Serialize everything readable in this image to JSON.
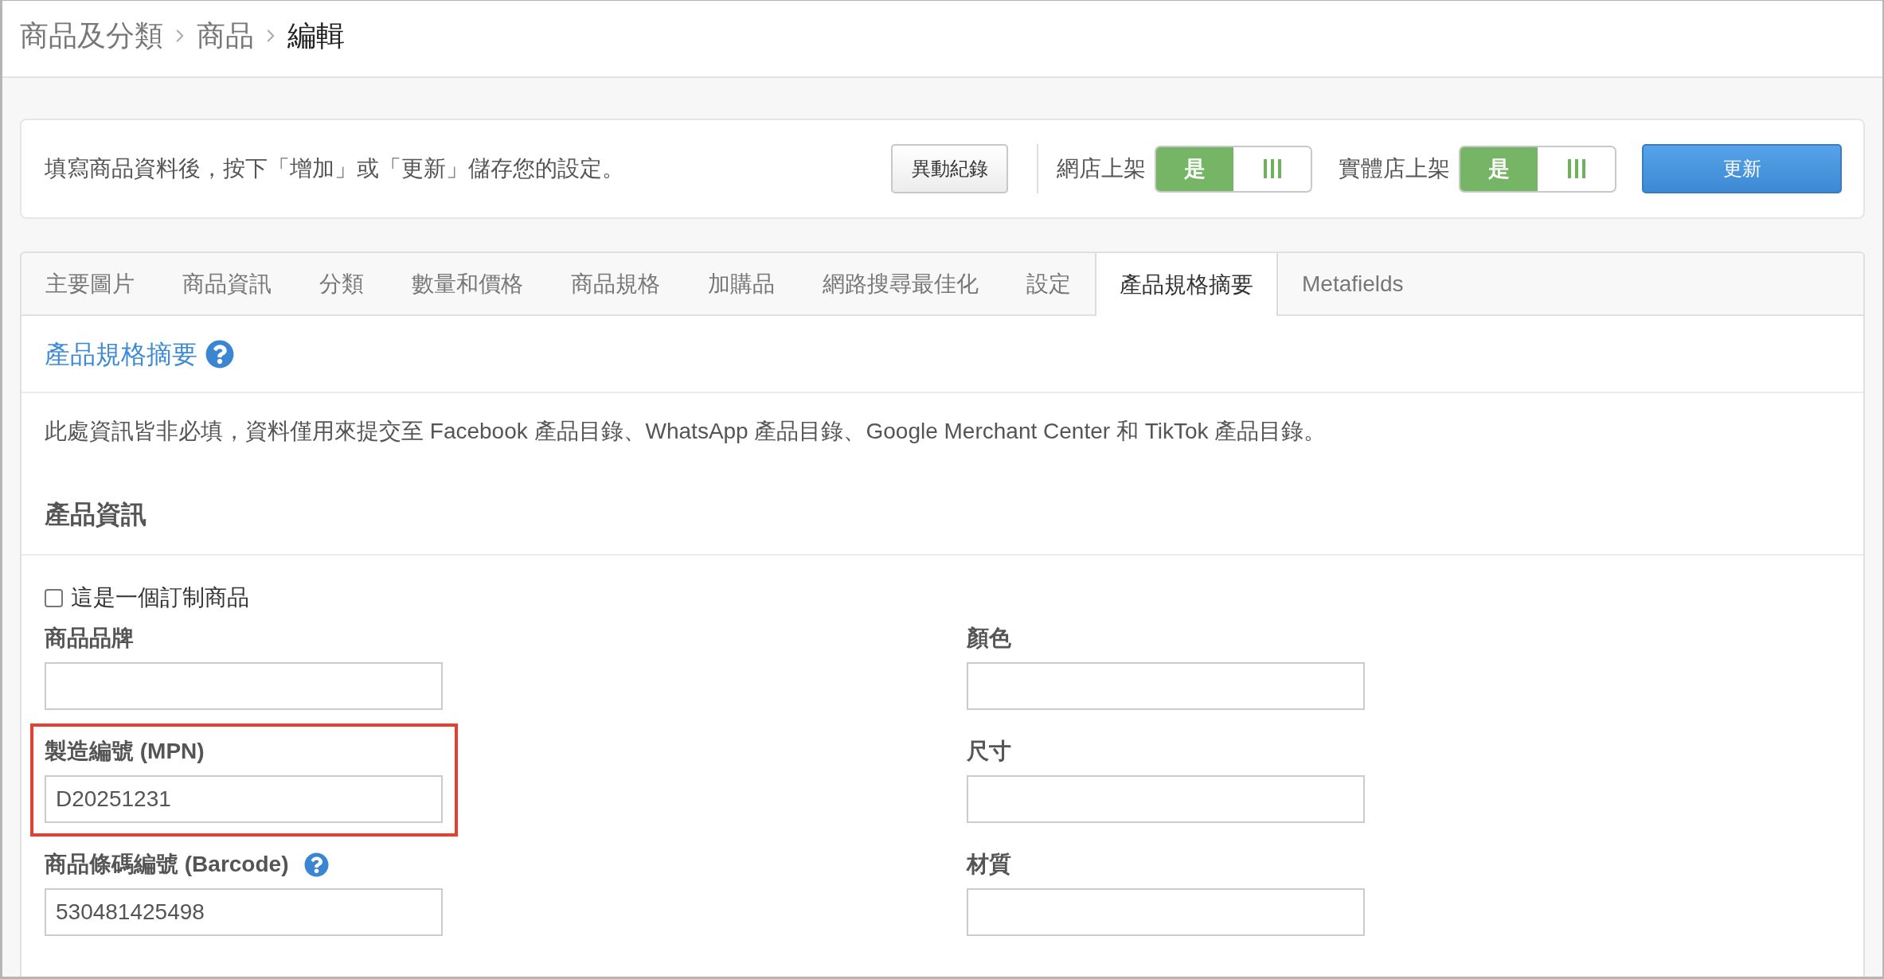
{
  "breadcrumb": [
    "商品及分類",
    "商品",
    "編輯"
  ],
  "action_bar": {
    "hint": "填寫商品資料後，按下「增加」或「更新」儲存您的設定。",
    "history_button": "異動紀錄",
    "toggles": [
      {
        "label": "網店上架",
        "on_text": "是",
        "on": true
      },
      {
        "label": "實體店上架",
        "on_text": "是",
        "on": true
      }
    ],
    "update_button": "更新"
  },
  "tabs": [
    {
      "label": "主要圖片",
      "selected": false
    },
    {
      "label": "商品資訊",
      "selected": false
    },
    {
      "label": "分類",
      "selected": false
    },
    {
      "label": "數量和價格",
      "selected": false
    },
    {
      "label": "商品規格",
      "selected": false
    },
    {
      "label": "加購品",
      "selected": false
    },
    {
      "label": "網路搜尋最佳化",
      "selected": false
    },
    {
      "label": "設定",
      "selected": false
    },
    {
      "label": "產品規格摘要",
      "selected": true
    },
    {
      "label": "Metafields",
      "selected": false
    }
  ],
  "panel": {
    "title": "產品規格摘要",
    "note": "此處資訊皆非必填，資料僅用來提交至 Facebook 產品目錄、WhatsApp 產品目錄、Google Merchant Center 和 TikTok 產品目錄。",
    "section_title": "產品資訊",
    "custom_product": {
      "label": "這是一個訂制商品",
      "checked": false
    },
    "columns": [
      {
        "fields": [
          {
            "label": "商品品牌"
          },
          {
            "label": "製造編號 (MPN)",
            "value": "D20251231",
            "highlighted": true
          },
          {
            "label": "商品條碼編號 (Barcode)",
            "value": "530481425498",
            "help": true
          }
        ]
      },
      {
        "fields": [
          {
            "label": "顏色"
          },
          {
            "label": "尺寸"
          },
          {
            "label": "材質"
          }
        ]
      }
    ]
  }
}
